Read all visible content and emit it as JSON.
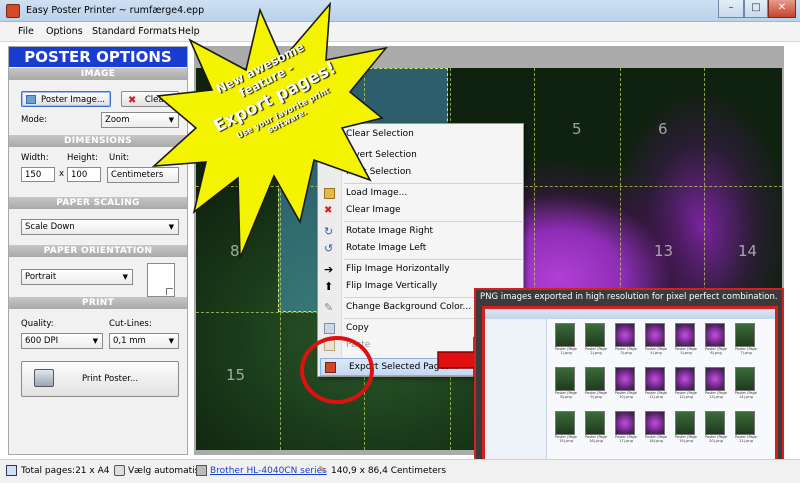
{
  "window": {
    "title": "Easy Poster Printer ~ rumfærge4.epp",
    "minimize": "–",
    "maximize": "□",
    "close": "✕"
  },
  "menu": [
    "File",
    "Options",
    "Standard Formats",
    "Help"
  ],
  "panel": {
    "header": "POSTER OPTIONS",
    "image": {
      "section": "IMAGE",
      "poster_button": "Poster Image...",
      "clear_button": "Clear",
      "mode_label": "Mode:",
      "mode_value": "Zoom"
    },
    "dimensions": {
      "section": "DIMENSIONS",
      "width_label": "Width:",
      "height_label": "Height:",
      "unit_label": "Unit:",
      "width_value": "150",
      "times": "x",
      "height_value": "100",
      "unit_value": "Centimeters"
    },
    "scaling": {
      "section": "PAPER SCALING",
      "value": "Scale Down"
    },
    "orientation": {
      "section": "PAPER ORIENTATION",
      "value": "Portrait"
    },
    "print": {
      "section": "PRINT",
      "quality_label": "Quality:",
      "quality_value": "600 DPI",
      "cutlines_label": "Cut-Lines:",
      "cutlines_value": "0,1 mm",
      "print_button": "Print Poster..."
    }
  },
  "canvas": {
    "page_numbers": [
      "5",
      "6",
      "8",
      "13",
      "14",
      "15"
    ]
  },
  "context_menu": {
    "items": [
      {
        "label": "Clear Selection",
        "icon": "none"
      },
      {
        "label": "Invert Selection",
        "icon": "none"
      },
      {
        "label": "Print Selection",
        "icon": "none"
      },
      {
        "label": "Load Image...",
        "icon": "open-icon"
      },
      {
        "label": "Clear Image",
        "icon": "clear-icon"
      },
      {
        "label": "Rotate Image Right",
        "icon": "rotate-right-icon"
      },
      {
        "label": "Rotate Image Left",
        "icon": "rotate-left-icon"
      },
      {
        "label": "Flip Image Horizontally",
        "icon": "flip-horizontal-icon"
      },
      {
        "label": "Flip Image Vertically",
        "icon": "flip-vertical-icon"
      },
      {
        "label": "Change Background Color...",
        "icon": "color-icon"
      },
      {
        "label": "Copy",
        "icon": "copy-icon"
      },
      {
        "label": "Paste",
        "icon": "paste-icon"
      },
      {
        "label": "Export Selected Pages...",
        "icon": "export-icon"
      }
    ]
  },
  "callout": {
    "line1": "New awesome",
    "line2": "feature -",
    "line3": "Export pages!",
    "line4": "Use your favorite print",
    "line5": "software."
  },
  "screenshot_inset": {
    "caption": "PNG images exported in high resolution for pixel perfect combination.",
    "thumbnails": [
      "Poster (Page 1).png",
      "Poster (Page 2).png",
      "Poster (Page 3).png",
      "Poster (Page 4).png",
      "Poster (Page 5).png",
      "Poster (Page 6).png",
      "Poster (Page 7).png",
      "Poster (Page 8).png",
      "Poster (Page 9).png",
      "Poster (Page 10).png",
      "Poster (Page 11).png",
      "Poster (Page 12).png",
      "Poster (Page 13).png",
      "Poster (Page 14).png",
      "Poster (Page 15).png",
      "Poster (Page 16).png",
      "Poster (Page 17).png",
      "Poster (Page 18).png",
      "Poster (Page 19).png",
      "Poster (Page 20).png",
      "Poster (Page 21).png"
    ]
  },
  "status": {
    "pages": "Total pages:21 x A4",
    "printer_auto": "Vælg automatisk",
    "printer_name": "Brother HL-4040CN series",
    "size": "140,9 x 86,4 Centimeters"
  },
  "colors": {
    "accent": "#1a3dd1",
    "highlight_red": "#d42020",
    "star_fill": "#f5f400"
  }
}
